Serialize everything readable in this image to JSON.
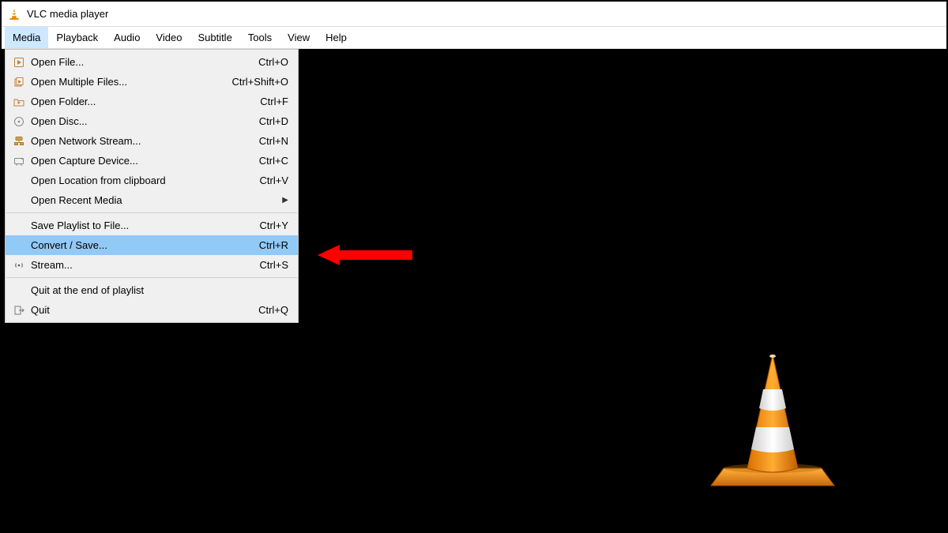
{
  "window": {
    "title": "VLC media player"
  },
  "menubar": {
    "items": [
      "Media",
      "Playback",
      "Audio",
      "Video",
      "Subtitle",
      "Tools",
      "View",
      "Help"
    ],
    "active_index": 0
  },
  "media_menu": {
    "groups": [
      [
        {
          "icon": "file-play-icon",
          "label": "Open File...",
          "shortcut": "Ctrl+O"
        },
        {
          "icon": "files-icon",
          "label": "Open Multiple Files...",
          "shortcut": "Ctrl+Shift+O"
        },
        {
          "icon": "folder-play-icon",
          "label": "Open Folder...",
          "shortcut": "Ctrl+F"
        },
        {
          "icon": "disc-icon",
          "label": "Open Disc...",
          "shortcut": "Ctrl+D"
        },
        {
          "icon": "network-icon",
          "label": "Open Network Stream...",
          "shortcut": "Ctrl+N"
        },
        {
          "icon": "capture-icon",
          "label": "Open Capture Device...",
          "shortcut": "Ctrl+C"
        },
        {
          "icon": "",
          "label": "Open Location from clipboard",
          "shortcut": "Ctrl+V"
        },
        {
          "icon": "",
          "label": "Open Recent Media",
          "shortcut": "",
          "submenu": true
        }
      ],
      [
        {
          "icon": "",
          "label": "Save Playlist to File...",
          "shortcut": "Ctrl+Y"
        },
        {
          "icon": "",
          "label": "Convert / Save...",
          "shortcut": "Ctrl+R",
          "highlight": true
        },
        {
          "icon": "stream-icon",
          "label": "Stream...",
          "shortcut": "Ctrl+S"
        }
      ],
      [
        {
          "icon": "",
          "label": "Quit at the end of playlist",
          "shortcut": ""
        },
        {
          "icon": "quit-icon",
          "label": "Quit",
          "shortcut": "Ctrl+Q"
        }
      ]
    ]
  },
  "annotation": {
    "arrow_color": "#ff0000"
  }
}
